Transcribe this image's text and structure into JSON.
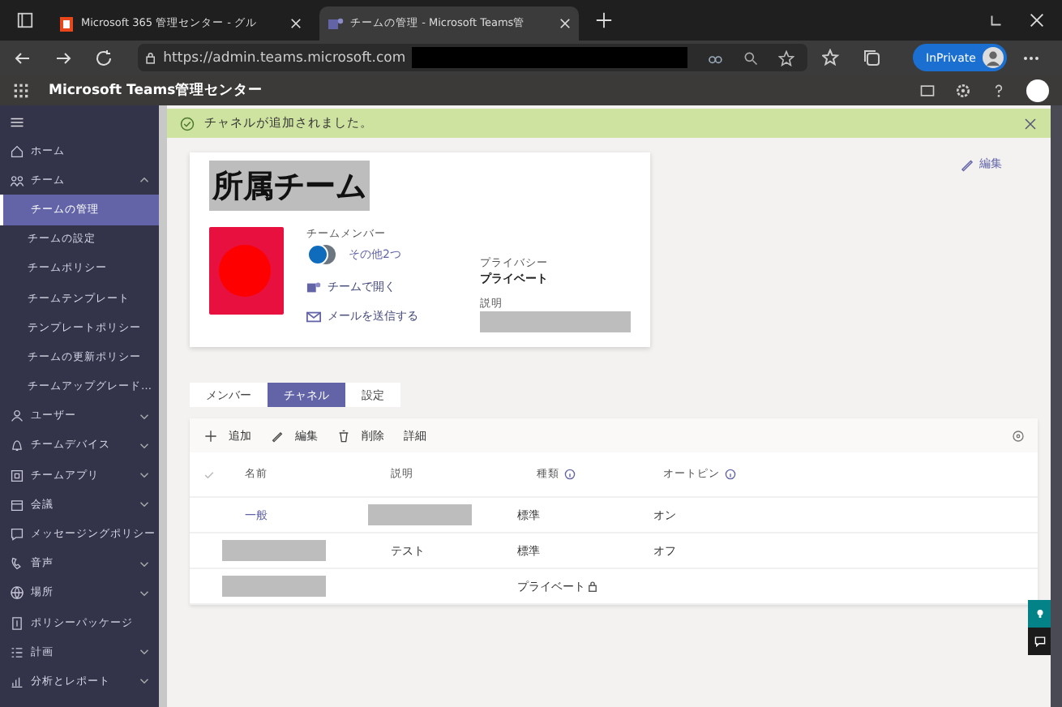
{
  "browser": {
    "tabs": [
      {
        "title": "Microsoft 365 管理センター - グル",
        "selected": false
      },
      {
        "title": "チームの管理 - Microsoft Teams管",
        "selected": true
      }
    ],
    "url": "https://admin.teams.microsoft.com",
    "inprivate": "InPrivate"
  },
  "app_header": {
    "title": "Microsoft Teams管理センター"
  },
  "banner": {
    "text": "チャネルが追加されました。"
  },
  "sidebar": {
    "items": [
      {
        "label": "ホーム",
        "selected": false
      },
      {
        "label": "チーム",
        "selected": false,
        "expanded": true,
        "children": [
          {
            "label": "チームの管理",
            "selected": true
          },
          {
            "label": "チームの設定",
            "selected": false
          },
          {
            "label": "チームポリシー",
            "selected": false
          },
          {
            "label": "チームテンプレート",
            "selected": false
          },
          {
            "label": "テンプレートポリシー",
            "selected": false
          },
          {
            "label": "チームの更新ポリシー",
            "selected": false
          },
          {
            "label": "チームアップグレード…",
            "selected": false
          }
        ]
      },
      {
        "label": "ユーザー",
        "selected": false,
        "expanded": false
      },
      {
        "label": "チームデバイス",
        "selected": false,
        "expanded": false
      },
      {
        "label": "チームアプリ",
        "selected": false,
        "expanded": false
      },
      {
        "label": "会議",
        "selected": false,
        "expanded": false
      },
      {
        "label": "メッセージングポリシー",
        "selected": false
      },
      {
        "label": "音声",
        "selected": false,
        "expanded": false
      },
      {
        "label": "場所",
        "selected": false,
        "expanded": false
      },
      {
        "label": "ポリシーパッケージ",
        "selected": false
      },
      {
        "label": "計画",
        "selected": false,
        "expanded": false
      },
      {
        "label": "分析とレポート",
        "selected": false,
        "expanded": false
      }
    ]
  },
  "team": {
    "title": "所属チーム",
    "edit": "編集",
    "members_label": "チームメンバー",
    "others": "その他2つ",
    "open": "チームで開く",
    "mail": "メールを送信する",
    "privacy_label": "プライバシー",
    "privacy_value": "プライベート",
    "description_label": "説明"
  },
  "tabs": [
    {
      "label": "メンバー",
      "selected": false
    },
    {
      "label": "チャネル",
      "selected": true
    },
    {
      "label": "設定",
      "selected": false
    }
  ],
  "toolbar": [
    {
      "label": "追加"
    },
    {
      "label": "編集"
    },
    {
      "label": "削除"
    },
    {
      "label": "詳細"
    }
  ],
  "table": {
    "columns": [
      {
        "label": "名前",
        "info": false
      },
      {
        "label": "説明",
        "info": false
      },
      {
        "label": "種類",
        "info": true
      },
      {
        "label": "オートピン",
        "info": true
      }
    ],
    "rows": [
      {
        "cells": [
          {
            "kind": "link",
            "text": "一般"
          },
          {
            "kind": "redacted"
          },
          {
            "kind": "text",
            "text": "標準"
          },
          {
            "kind": "text",
            "text": "オン"
          }
        ]
      },
      {
        "cells": [
          {
            "kind": "redacted"
          },
          {
            "kind": "text",
            "text": "テスト"
          },
          {
            "kind": "text",
            "text": "標準"
          },
          {
            "kind": "text",
            "text": "オフ"
          }
        ]
      },
      {
        "cells": [
          {
            "kind": "redacted"
          },
          {
            "kind": "empty"
          },
          {
            "kind": "private",
            "text": "プライベート"
          },
          {
            "kind": "empty"
          }
        ]
      }
    ]
  }
}
